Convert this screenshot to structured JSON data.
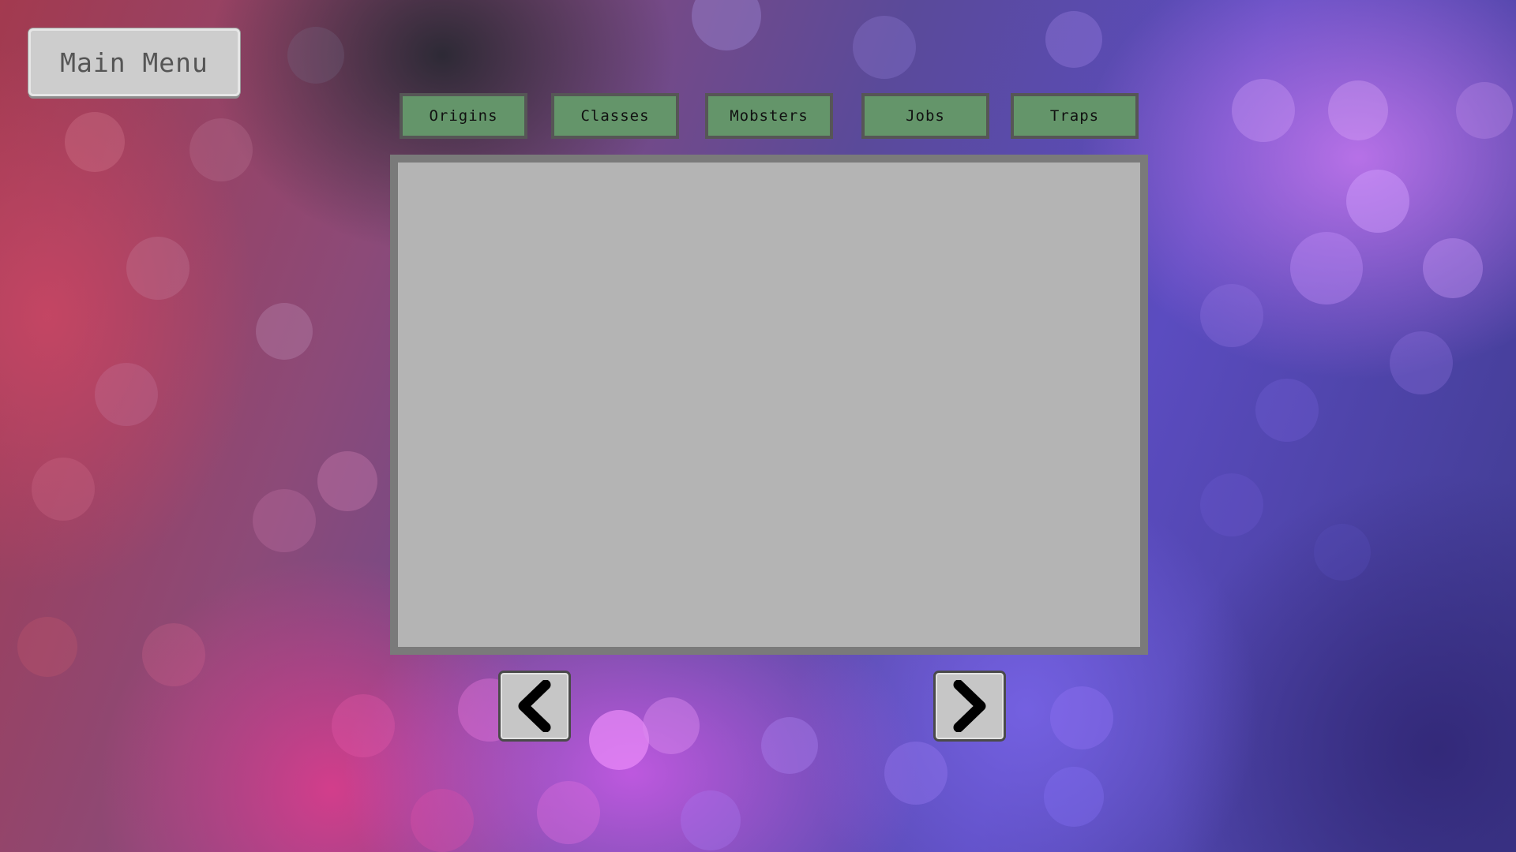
{
  "main_menu": {
    "label": "Main Menu"
  },
  "tabs": [
    {
      "label": "Origins"
    },
    {
      "label": "Classes"
    },
    {
      "label": "Mobsters"
    },
    {
      "label": "Jobs"
    },
    {
      "label": "Traps"
    }
  ],
  "content_panel": {
    "text": ""
  },
  "navigation": {
    "prev_icon": "chevron-left-icon",
    "next_icon": "chevron-right-icon"
  },
  "colors": {
    "tab_bg": "#64956a",
    "tab_border": "#565656",
    "panel_bg": "#b4b4b4",
    "panel_border": "#7a7a7a",
    "button_bg": "#cdcdcd"
  }
}
